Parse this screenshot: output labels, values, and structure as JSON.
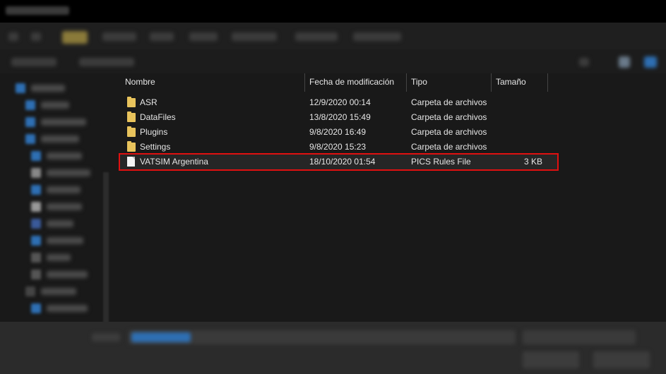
{
  "columns": {
    "name": "Nombre",
    "modified": "Fecha de modificación",
    "type": "Tipo",
    "size": "Tamaño"
  },
  "files": [
    {
      "name": "ASR",
      "modified": "12/9/2020 00:14",
      "type": "Carpeta de archivos",
      "size": "",
      "icon": "folder-icon"
    },
    {
      "name": "DataFiles",
      "modified": "13/8/2020 15:49",
      "type": "Carpeta de archivos",
      "size": "",
      "icon": "folder-icon"
    },
    {
      "name": "Plugins",
      "modified": "9/8/2020 16:49",
      "type": "Carpeta de archivos",
      "size": "",
      "icon": "folder-icon"
    },
    {
      "name": "Settings",
      "modified": "9/8/2020 15:23",
      "type": "Carpeta de archivos",
      "size": "",
      "icon": "folder-icon"
    },
    {
      "name": "VATSIM Argentina",
      "modified": "18/10/2020 01:54",
      "type": "PICS Rules File",
      "size": "3 KB",
      "icon": "file-icon"
    }
  ],
  "highlight_color": "#e01010",
  "folder_color": "#e8c35c"
}
